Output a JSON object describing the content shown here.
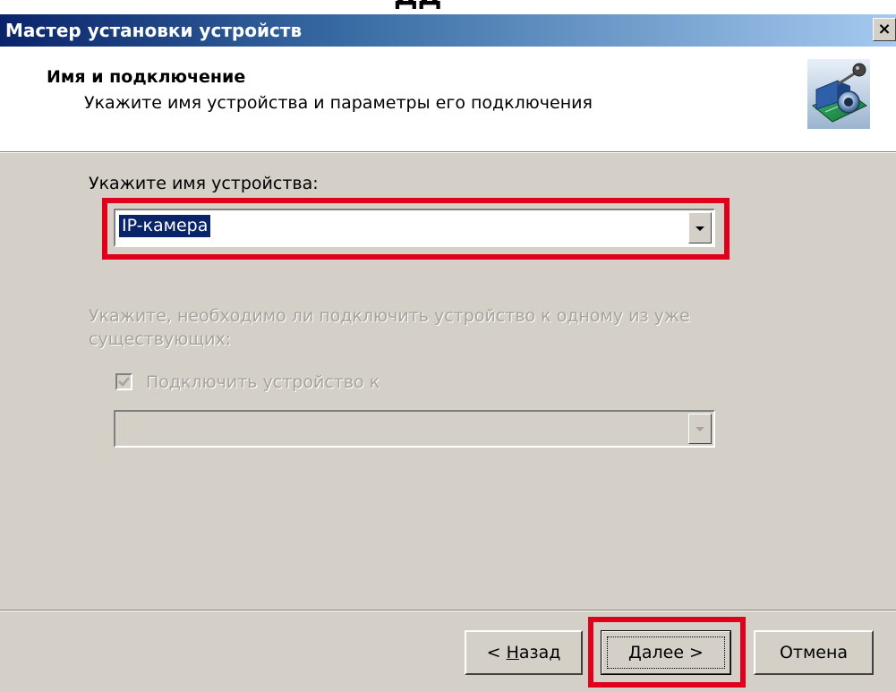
{
  "window": {
    "caption_fragment": "ДД",
    "title": "Мастер установки устройств",
    "close_glyph": "×"
  },
  "header": {
    "title": "Имя и подключение",
    "subtitle": "Укажите имя устройства и параметры его подключения",
    "icon": "camera-microphone-device-icon"
  },
  "device_name": {
    "label": "Укажите имя устройства:",
    "value": "IP-камера",
    "highlighted": true
  },
  "connect": {
    "question": "Укажите, необходимо ли подключить устройство к одному из уже",
    "question_line2": "существующих:",
    "checkbox_label": "Подключить устройство к",
    "checkbox_checked": true,
    "enabled": false,
    "combo_value": ""
  },
  "buttons": {
    "back_prefix": "< ",
    "back_mnemonic": "Н",
    "back_rest": "азад",
    "next_mnemonic": "Д",
    "next_rest": "алее >",
    "cancel": "Отмена"
  },
  "colors": {
    "titlebar_start": "#0a246a",
    "titlebar_end": "#a6caf0",
    "dialog_face": "#d4d0c8",
    "selection": "#0a246a",
    "annotation_red": "#e0001b",
    "disabled_text": "#a6a39b"
  }
}
